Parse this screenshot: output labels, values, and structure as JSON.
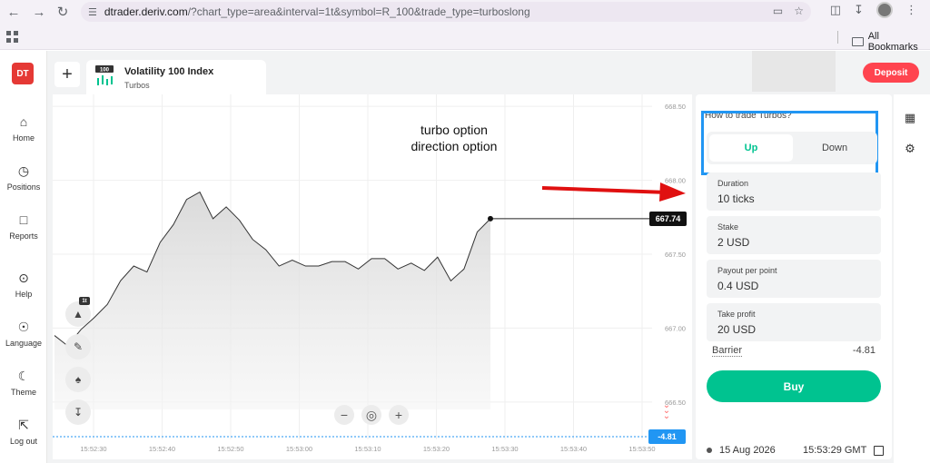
{
  "browser": {
    "url_host": "dtrader.deriv.com",
    "url_rest": "/?chart_type=area&interval=1t&symbol=R_100&trade_type=turboslong",
    "all_bookmarks": "All Bookmarks"
  },
  "sidebar": {
    "logo": "DT",
    "items": [
      {
        "label": "Home",
        "icon": "home-icon"
      },
      {
        "label": "Positions",
        "icon": "clock-icon"
      },
      {
        "label": "Reports",
        "icon": "document-icon"
      },
      {
        "label": "Help",
        "icon": "help-icon"
      },
      {
        "label": "Language",
        "icon": "globe-icon"
      },
      {
        "label": "Theme",
        "icon": "moon-icon"
      },
      {
        "label": "Log out",
        "icon": "logout-icon"
      }
    ]
  },
  "header": {
    "market_name": "Volatility 100 Index",
    "market_sub": "Turbos",
    "market_badge": "100",
    "deposit_label": "Deposit"
  },
  "chart": {
    "current_price": "667.74",
    "barrier_tag": "-4.81",
    "chart_type_badge": "1t",
    "y_labels": [
      "668.50",
      "668.00",
      "667.50",
      "667.00",
      "666.50"
    ],
    "x_labels": [
      "15:52:30",
      "15:52:40",
      "15:52:50",
      "15:53:00",
      "15:53:10",
      "15:53:20",
      "15:53:30",
      "15:53:40",
      "15:53:50"
    ]
  },
  "chart_data": {
    "type": "area",
    "x": [
      0,
      1,
      2,
      3,
      4,
      5,
      6,
      7,
      8,
      9,
      10,
      11,
      12,
      13,
      14,
      15,
      16,
      17,
      18,
      19,
      20,
      21,
      22,
      23,
      24,
      25,
      26,
      27,
      28,
      29,
      30,
      31,
      32
    ],
    "values": [
      666.95,
      666.88,
      666.99,
      667.07,
      667.16,
      667.32,
      667.42,
      667.38,
      667.58,
      667.7,
      667.87,
      667.92,
      667.74,
      667.82,
      667.73,
      667.6,
      667.53,
      667.42,
      667.46,
      667.42,
      667.42,
      667.45,
      667.45,
      667.4,
      667.47,
      667.47,
      667.4,
      667.44,
      667.39,
      667.48,
      667.32,
      667.4,
      667.65,
      667.74
    ],
    "ylim": [
      666.45,
      668.55
    ],
    "title": "",
    "xlabel": "",
    "ylabel": ""
  },
  "annotation": {
    "line1": "turbo option",
    "line2": "direction option"
  },
  "trade": {
    "howto": "How to trade Turbos?",
    "up_label": "Up",
    "down_label": "Down",
    "fields": [
      {
        "label": "Duration",
        "value": "10 ticks"
      },
      {
        "label": "Stake",
        "value": "2 USD"
      },
      {
        "label": "Payout per point",
        "value": "0.4 USD"
      },
      {
        "label": "Take profit",
        "value": "20 USD"
      }
    ],
    "barrier_label": "Barrier",
    "barrier_value": "-4.81",
    "buy_label": "Buy"
  },
  "status": {
    "date": "15 Aug 2026",
    "time": "15:53:29 GMT"
  },
  "colors": {
    "accent_red": "#ff444f",
    "up_green": "#00c390",
    "highlight_blue": "#2196f3"
  }
}
